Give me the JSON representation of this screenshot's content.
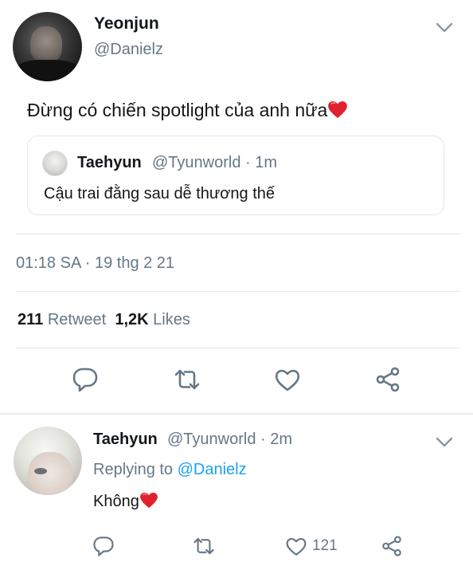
{
  "main_tweet": {
    "name": "Yeonjun",
    "handle": "@Danielz",
    "text": "Đừng có chiến spotlight của anh nữa",
    "timestamp": "01:18 SA · 19 thg 2 21",
    "retweets_count": "211",
    "retweets_label": "Retweet",
    "likes_count": "1,2K",
    "likes_label": "Likes"
  },
  "quoted_tweet": {
    "name": "Taehyun",
    "meta": "@Tyunworld · 1m",
    "text": "Cậu trai đằng sau dễ thương thế"
  },
  "reply": {
    "name": "Taehyun",
    "meta": "@Tyunworld · 2m",
    "replying_prefix": "Replying to",
    "replying_to": "@Danielz",
    "text": "Không",
    "like_count": "121"
  },
  "icons": {
    "reply": "reply-icon",
    "retweet": "retweet-icon",
    "like": "heart-icon",
    "share": "share-icon",
    "more": "chevron-down-icon",
    "emoji": "red-heart-emoji"
  },
  "colors": {
    "text": "#14171a",
    "secondary": "#657786",
    "link": "#1da1f2",
    "divider": "#e1e8ed",
    "heart_emoji": "#e0222f"
  }
}
